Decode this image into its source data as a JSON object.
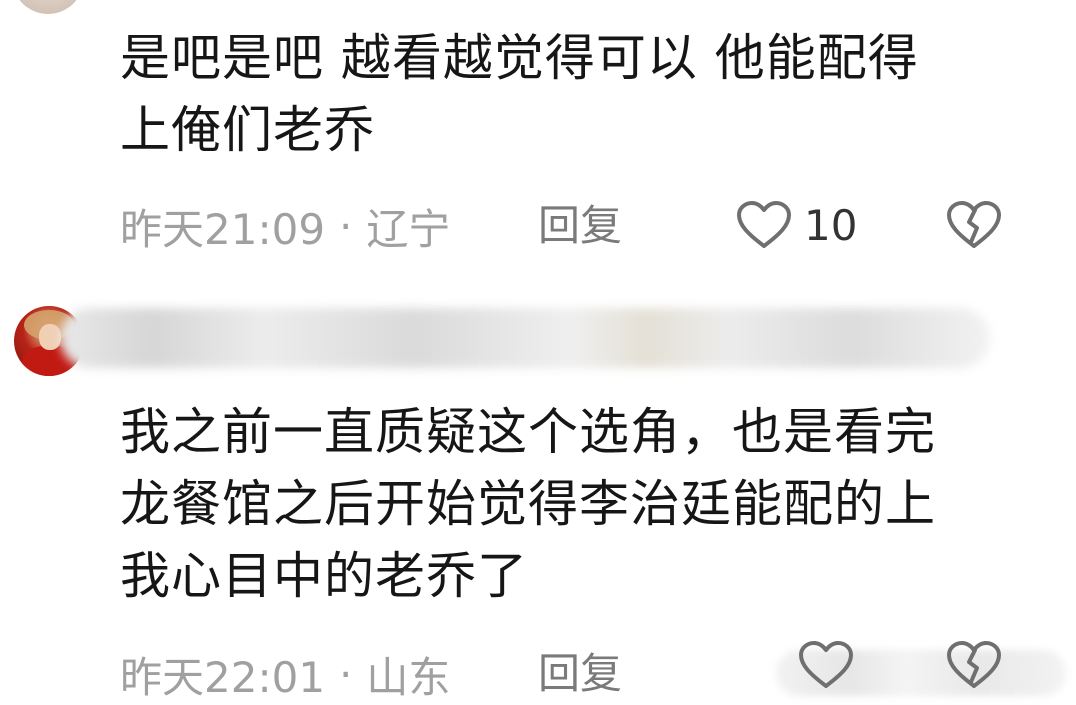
{
  "comments": [
    {
      "text_lines": [
        "是吧是吧 越看越觉得可以 他能配得",
        "上俺们老乔"
      ],
      "time": "昨天21:09",
      "separator": "·",
      "location": "辽宁",
      "reply_label": "回复",
      "like_count": "10",
      "icons": {
        "like": "heart-outline-icon",
        "dislike": "broken-heart-icon"
      }
    },
    {
      "text_lines": [
        "我之前一直质疑这个选角，也是看完",
        "龙餐馆之后开始觉得李治廷能配的上",
        "我心目中的老乔了"
      ],
      "time": "昨天22:01",
      "separator": "·",
      "location": "山东",
      "reply_label": "回复",
      "icons": {
        "like": "heart-outline-icon",
        "dislike": "broken-heart-icon"
      }
    }
  ],
  "colors": {
    "text": "#161616",
    "meta": "#a0a0a0",
    "icon": "#6f6f6f"
  }
}
